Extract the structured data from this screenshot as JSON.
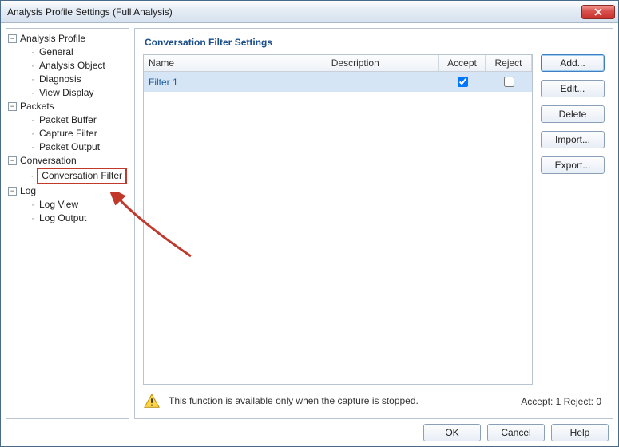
{
  "window": {
    "title": "Analysis Profile Settings (Full Analysis)"
  },
  "tree": {
    "analysis_profile": {
      "label": "Analysis Profile",
      "general": "General",
      "analysis_object": "Analysis Object",
      "diagnosis": "Diagnosis",
      "view_display": "View Display"
    },
    "packets": {
      "label": "Packets",
      "packet_buffer": "Packet Buffer",
      "capture_filter": "Capture Filter",
      "packet_output": "Packet Output"
    },
    "conversation": {
      "label": "Conversation",
      "conversation_filter": "Conversation Filter"
    },
    "log": {
      "label": "Log",
      "log_view": "Log View",
      "log_output": "Log Output"
    }
  },
  "panel": {
    "title": "Conversation Filter Settings"
  },
  "table": {
    "headers": {
      "name": "Name",
      "description": "Description",
      "accept": "Accept",
      "reject": "Reject"
    },
    "rows": [
      {
        "name": "Filter 1",
        "description": "",
        "accept": true,
        "reject": false
      }
    ]
  },
  "buttons": {
    "add": "Add...",
    "edit": "Edit...",
    "delete": "Delete",
    "import": "Import...",
    "export": "Export..."
  },
  "note": "This function is available only when the capture is stopped.",
  "summary": {
    "label": "Accept: 1 Reject: 0",
    "accept": 1,
    "reject": 0
  },
  "dialog_buttons": {
    "ok": "OK",
    "cancel": "Cancel",
    "help": "Help"
  },
  "icons": {
    "expander_collapsed": "+",
    "expander_expanded": "−"
  }
}
